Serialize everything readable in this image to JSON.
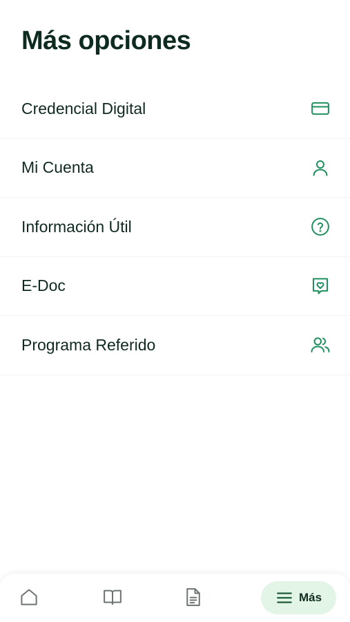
{
  "header": {
    "title": "Más opciones"
  },
  "menu": {
    "items": [
      {
        "label": "Credencial Digital",
        "icon": "credit-card-icon"
      },
      {
        "label": "Mi Cuenta",
        "icon": "user-icon"
      },
      {
        "label": "Información Útil",
        "icon": "help-circle-icon"
      },
      {
        "label": "E-Doc",
        "icon": "heart-chat-icon"
      },
      {
        "label": "Programa Referido",
        "icon": "users-icon"
      }
    ]
  },
  "bottom_nav": {
    "items": [
      {
        "icon": "home-icon"
      },
      {
        "icon": "book-icon"
      },
      {
        "icon": "document-icon"
      }
    ],
    "more": {
      "label": "Más",
      "icon": "menu-icon",
      "active": true
    }
  },
  "colors": {
    "accent": "#1e8f5e",
    "active_pill": "#e3f5e6",
    "text": "#0f2e22"
  }
}
